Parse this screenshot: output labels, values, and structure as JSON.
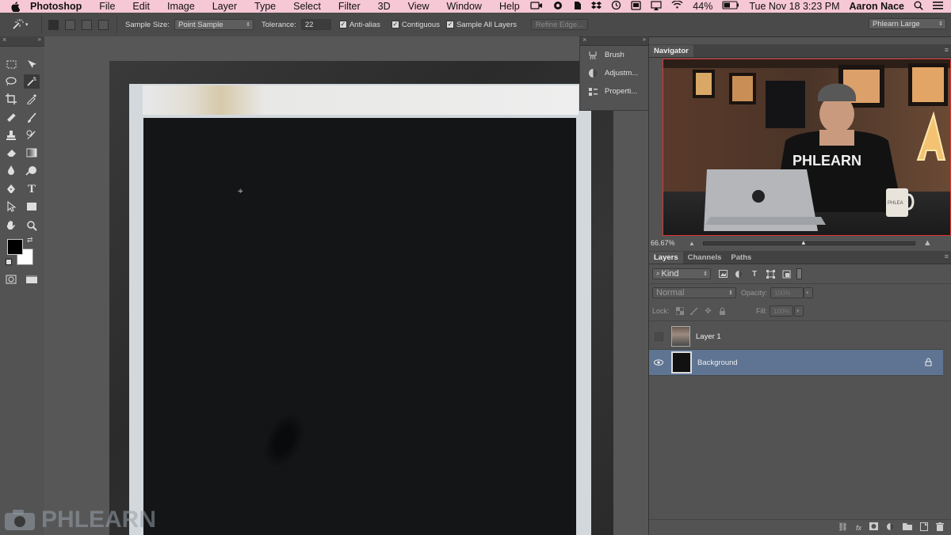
{
  "menubar": {
    "app_name": "Photoshop",
    "items": [
      "File",
      "Edit",
      "Image",
      "Layer",
      "Type",
      "Select",
      "Filter",
      "3D",
      "View",
      "Window",
      "Help"
    ],
    "battery": "44%",
    "datetime": "Tue Nov 18  3:23 PM",
    "user": "Aaron Nace"
  },
  "options": {
    "sample_size_label": "Sample Size:",
    "sample_size_value": "Point Sample",
    "tolerance_label": "Tolerance:",
    "tolerance_value": "22",
    "anti_alias": "Anti-alias",
    "contiguous": "Contiguous",
    "sample_all_layers": "Sample All Layers",
    "refine_edge": "Refine Edge...",
    "workspace": "Phlearn Large"
  },
  "dock": {
    "items": [
      {
        "label": "Brush",
        "icon": "brush-panel-icon"
      },
      {
        "label": "Adjustm...",
        "icon": "adjustments-icon"
      },
      {
        "label": "Properti...",
        "icon": "properties-icon"
      }
    ]
  },
  "navigator": {
    "tab": "Navigator",
    "zoom": "66.67%",
    "shirt_text": "PHLEARN",
    "mug_text": "PHLEA",
    "sign_letter": "A"
  },
  "layers_panel": {
    "tabs": [
      "Layers",
      "Channels",
      "Paths"
    ],
    "filter": "Kind",
    "blend_mode": "Normal",
    "opacity_label": "Opacity:",
    "opacity_value": "100%",
    "lock_label": "Lock:",
    "fill_label": "Fill:",
    "fill_value": "100%",
    "layers": [
      {
        "name": "Layer 1",
        "visible": false,
        "selected": false
      },
      {
        "name": "Background",
        "visible": true,
        "selected": true,
        "locked": true
      }
    ]
  },
  "watermark": "PHLEARN",
  "colors": {
    "menubar": "#f6c7d5",
    "panel": "#535353",
    "selected_layer": "#5e7492"
  }
}
